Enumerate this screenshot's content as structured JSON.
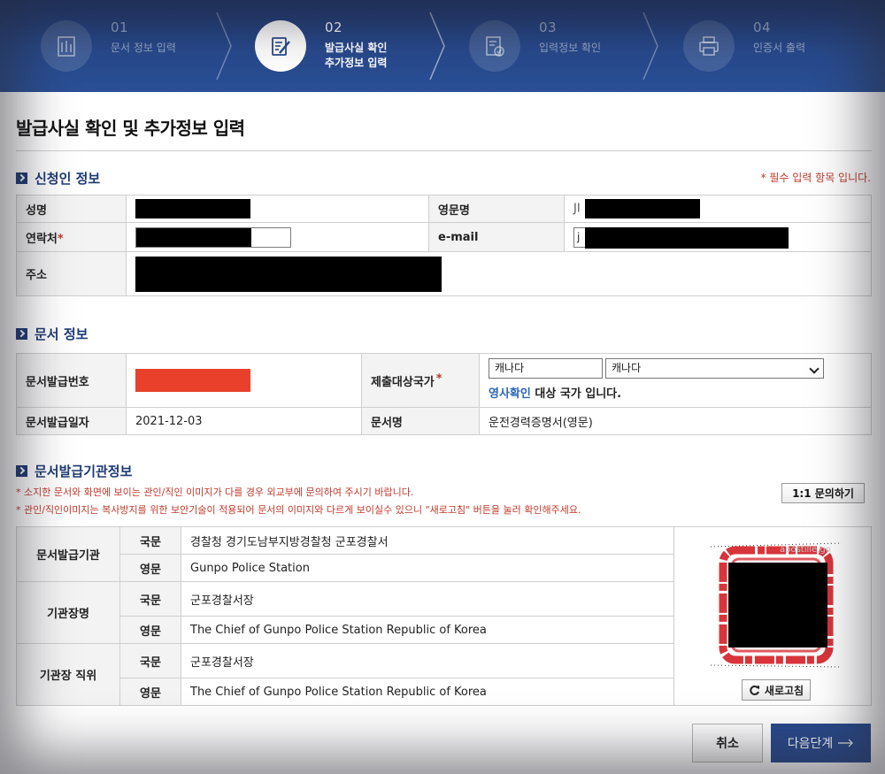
{
  "steps": [
    {
      "num": "01",
      "label": "문서 정보 입력",
      "icon": "building-icon",
      "active": false
    },
    {
      "num": "02",
      "label_line1": "발급사실 확인",
      "label_line2": "추가정보 입력",
      "icon": "edit-document-icon",
      "active": true
    },
    {
      "num": "03",
      "label": "입력정보 확인",
      "icon": "document-check-icon",
      "active": false
    },
    {
      "num": "04",
      "label": "인증서 출력",
      "icon": "printer-icon",
      "active": false
    }
  ],
  "page_title": "발급사실 확인 및 추가정보 입력",
  "applicant": {
    "section_title": "신청인 정보",
    "required_note": "* 필수 입력 항목 입니다.",
    "name_label": "성명",
    "eng_name_label": "영문명",
    "eng_name_prefix": "JI",
    "contact_label": "연락처",
    "email_label": "e-mail",
    "email_prefix": "j",
    "address_label": "주소",
    "required_mark": "*"
  },
  "document": {
    "section_title": "문서 정보",
    "issue_no_label": "문서발급번호",
    "country_label": "제출대상국가",
    "country_input_value": "캐나다",
    "country_select_value": "캐나다",
    "consul_link": "영사확인",
    "consul_note": " 대상 국가 입니다.",
    "issue_date_label": "문서발급일자",
    "issue_date": "2021-12-03",
    "doc_name_label": "문서명",
    "doc_name": "운전경력증명서(영문)"
  },
  "issuer": {
    "section_title": "문서발급기관정보",
    "note1": "* 소지한 문서와 화면에 보이는 관인/직인 이미지가 다를 경우 외교부에 문의하여 주시기 바랍니다.",
    "note2": "* 관인/직인이미지는 복사방지를 위한 보안기술이 적용되어 문서의 이미지와 다르게 보이실수 있으니 \"새로고침\" 버튼을 눌러 확인해주세요.",
    "inquiry_button": "1:1 문의하기",
    "ko_label": "국문",
    "en_label": "영문",
    "org_label": "문서발급기관",
    "org_ko": "경찰청 경기도남부지방경찰청 군포경찰서",
    "org_en": "Gunpo Police Station",
    "head_label": "기관장명",
    "head_ko": "군포경찰서장",
    "head_en": "The Chief of Gunpo Police Station Republic of Korea",
    "position_label": "기관장 직위",
    "position_ko": "군포경찰서장",
    "position_en": "The Chief of Gunpo Police Station Republic of Korea",
    "seal_watermark": "apostille.go",
    "refresh_button": "새로고침"
  },
  "buttons": {
    "cancel": "취소",
    "next": "다음단계"
  },
  "colors": {
    "header_bg": "#27498c",
    "section_title": "#1d3a74",
    "required_red": "#c0392b",
    "link_blue": "#2b66b8",
    "redaction_red": "#e8402a",
    "seal_red": "#d8343a"
  }
}
